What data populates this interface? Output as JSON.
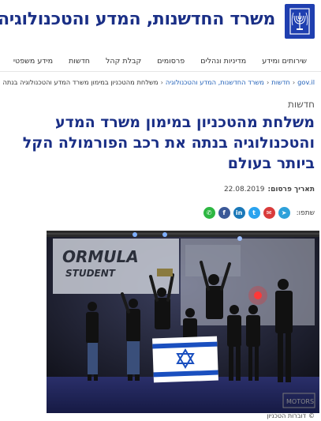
{
  "header": {
    "site_title": "משרד החדשנות, המדע והטכנולוגיה",
    "emblem_icon": "state-emblem-icon",
    "brand_color": "#1a2f86"
  },
  "nav": {
    "items": [
      {
        "label": "שירותים ומידע"
      },
      {
        "label": "מדיניות ונהלים"
      },
      {
        "label": "פרסומים"
      },
      {
        "label": "קבלת קהל"
      },
      {
        "label": "חדשות"
      },
      {
        "label": "מידע משפטי"
      }
    ]
  },
  "breadcrumb": {
    "items": [
      {
        "label": "gov.il"
      },
      {
        "label": "חדשות"
      },
      {
        "label": "משרד החדשנות, המדע והטכנולוגיה"
      }
    ],
    "current": "משלחת מהטכניון במימון משרד המדע והטכנולוגיה בנתה את רכב הפורמולה הקל ביותר בעולם",
    "separator": "‹"
  },
  "article": {
    "category": "חדשות",
    "headline": "משלחת מהטכניון במימון משרד המדע והטכנולוגיה בנתה את רכב הפורמולה הקל ביותר בעולם",
    "date_label": "תאריך פרסום:",
    "date_value": "22.08.2019"
  },
  "share": {
    "label": "שתפו:",
    "buttons": [
      {
        "name": "telegram-icon",
        "glyph": "➤",
        "color": "#2ea1da"
      },
      {
        "name": "email-icon",
        "glyph": "✉",
        "color": "#d93b3b"
      },
      {
        "name": "twitter-icon",
        "glyph": "t",
        "color": "#2aa3ef"
      },
      {
        "name": "linkedin-icon",
        "glyph": "in",
        "color": "#1a78b8"
      },
      {
        "name": "facebook-icon",
        "glyph": "f",
        "color": "#3b5998"
      },
      {
        "name": "whatsapp-icon",
        "glyph": "✆",
        "color": "#2db742"
      }
    ]
  },
  "photo": {
    "banner_text_1": "ORMULA",
    "banner_text_2": "STUDENT",
    "watermark": "MOTORS"
  },
  "caption": {
    "copyright_icon": "copyright-icon",
    "text": "דוברות הטכניון"
  }
}
